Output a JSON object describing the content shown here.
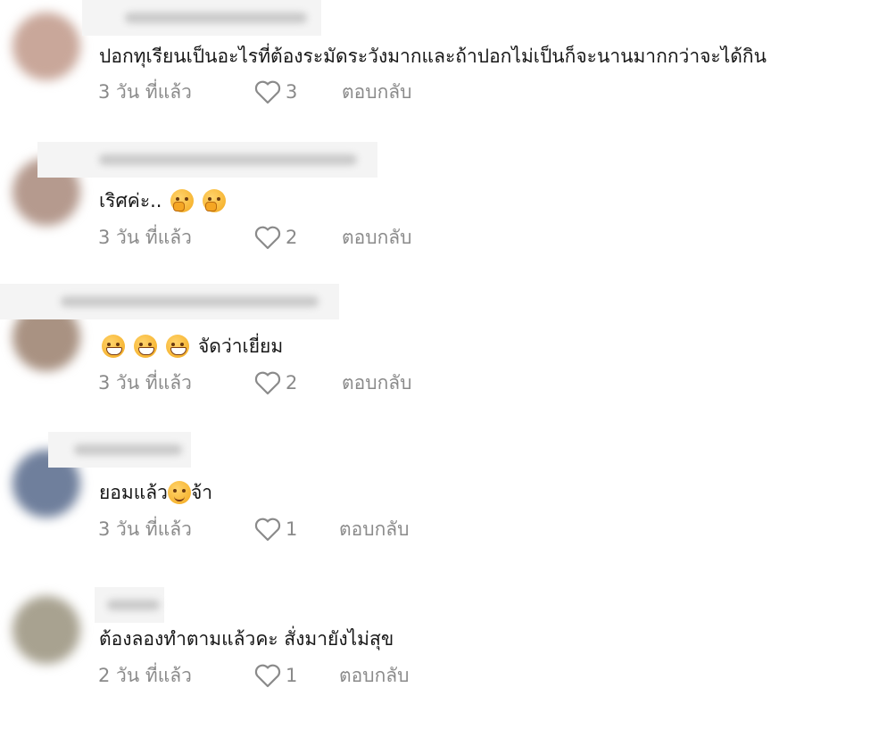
{
  "comments": [
    {
      "text": "ปอกทุเรียนเป็นอะไรที่ต้องระมัดระวังมากและถ้าปอกไม่เป็นก็จะนานมากกว่าจะได้กิน",
      "time": "3 วัน ที่แล้ว",
      "likes": "3",
      "reply_label": "ตอบกลับ"
    },
    {
      "text": "เริศค่ะ..",
      "time": "3 วัน ที่แล้ว",
      "likes": "2",
      "reply_label": "ตอบกลับ"
    },
    {
      "text": "จัดว่าเยี่ยม",
      "time": "3 วัน ที่แล้ว",
      "likes": "2",
      "reply_label": "ตอบกลับ"
    },
    {
      "text_before": "ยอมแล้ว",
      "text_after": "จ้า",
      "time": "3 วัน ที่แล้ว",
      "likes": "1",
      "reply_label": "ตอบกลับ"
    },
    {
      "text": "ต้องลองทำตามแล้วคะ สั่งมายังไม่สุข",
      "time": "2 วัน ที่แล้ว",
      "likes": "1",
      "reply_label": "ตอบกลับ"
    }
  ],
  "icons": {
    "like": "heart-outline-icon",
    "emoji_shy": "face-with-hand-over-mouth-emoji",
    "emoji_grin": "grinning-face-emoji",
    "emoji_smile": "smiling-face-emoji"
  },
  "colors": {
    "text": "#161616",
    "meta": "#8a8a8a",
    "background": "#ffffff"
  }
}
